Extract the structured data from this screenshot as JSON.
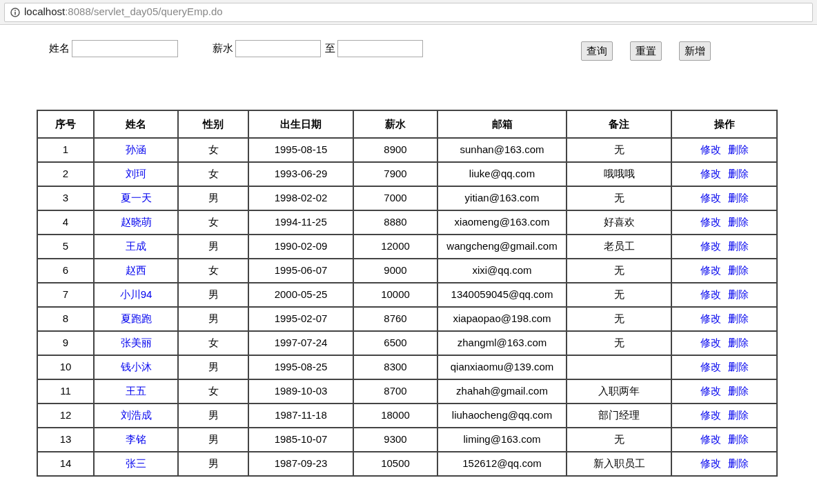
{
  "address_bar": {
    "host": "localhost",
    "path": ":8088/servlet_day05/queryEmp.do"
  },
  "search": {
    "fields": [
      {
        "label": "姓名"
      },
      {
        "label": "薪水"
      },
      {
        "label": "至"
      }
    ],
    "buttons": [
      "查询",
      "重置",
      "新增"
    ]
  },
  "table": {
    "columns": [
      "序号",
      "姓名",
      "性别",
      "出生日期",
      "薪水",
      "邮箱",
      "备注",
      "操作"
    ],
    "rows": [
      {
        "no": "1",
        "name": "孙涵",
        "gender": "女",
        "birth": "1995-08-15",
        "salary": "8900",
        "email": "sunhan@163.com",
        "note": "无",
        "actions": [
          "修改",
          "删除"
        ]
      },
      {
        "no": "2",
        "name": "刘珂",
        "gender": "女",
        "birth": "1993-06-29",
        "salary": "7900",
        "email": "liuke@qq.com",
        "note": "哦哦哦",
        "actions": [
          "修改",
          "删除"
        ]
      },
      {
        "no": "3",
        "name": "夏一天",
        "gender": "男",
        "birth": "1998-02-02",
        "salary": "7000",
        "email": "yitian@163.com",
        "note": "无",
        "actions": [
          "修改",
          "删除"
        ]
      },
      {
        "no": "4",
        "name": "赵晓萌",
        "gender": "女",
        "birth": "1994-11-25",
        "salary": "8880",
        "email": "xiaomeng@163.com",
        "note": "好喜欢",
        "actions": [
          "修改",
          "删除"
        ]
      },
      {
        "no": "5",
        "name": "王成",
        "gender": "男",
        "birth": "1990-02-09",
        "salary": "12000",
        "email": "wangcheng@gmail.com",
        "note": "老员工",
        "actions": [
          "修改",
          "删除"
        ]
      },
      {
        "no": "6",
        "name": "赵西",
        "gender": "女",
        "birth": "1995-06-07",
        "salary": "9000",
        "email": "xixi@qq.com",
        "note": "无",
        "actions": [
          "修改",
          "删除"
        ]
      },
      {
        "no": "7",
        "name": "小川94",
        "gender": "男",
        "birth": "2000-05-25",
        "salary": "10000",
        "email": "1340059045@qq.com",
        "note": "无",
        "actions": [
          "修改",
          "删除"
        ]
      },
      {
        "no": "8",
        "name": "夏跑跑",
        "gender": "男",
        "birth": "1995-02-07",
        "salary": "8760",
        "email": "xiapaopao@198.com",
        "note": "无",
        "actions": [
          "修改",
          "删除"
        ]
      },
      {
        "no": "9",
        "name": "张美丽",
        "gender": "女",
        "birth": "1997-07-24",
        "salary": "6500",
        "email": "zhangml@163.com",
        "note": "无",
        "actions": [
          "修改",
          "删除"
        ]
      },
      {
        "no": "10",
        "name": "钱小沐",
        "gender": "男",
        "birth": "1995-08-25",
        "salary": "8300",
        "email": "qianxiaomu@139.com",
        "actions": [
          "修改",
          "删除"
        ]
      },
      {
        "no": "11",
        "name": "王五",
        "gender": "女",
        "birth": "1989-10-03",
        "salary": "8700",
        "email": "zhahah@gmail.com",
        "note": "入职两年",
        "actions": [
          "修改",
          "删除"
        ]
      },
      {
        "no": "12",
        "name": "刘浩成",
        "gender": "男",
        "birth": "1987-11-18",
        "salary": "18000",
        "email": "liuhaocheng@qq.com",
        "note": "部门经理",
        "actions": [
          "修改",
          "删除"
        ]
      },
      {
        "no": "13",
        "name": "李铭",
        "gender": "男",
        "birth": "1985-10-07",
        "salary": "9300",
        "email": "liming@163.com",
        "note": "无",
        "actions": [
          "修改",
          "删除"
        ]
      },
      {
        "no": "14",
        "name": "张三",
        "gender": "男",
        "birth": "1987-09-23",
        "salary": "10500",
        "email": "152612@qq.com",
        "note": "新入职员工",
        "actions": [
          "修改",
          "删除"
        ]
      }
    ]
  }
}
